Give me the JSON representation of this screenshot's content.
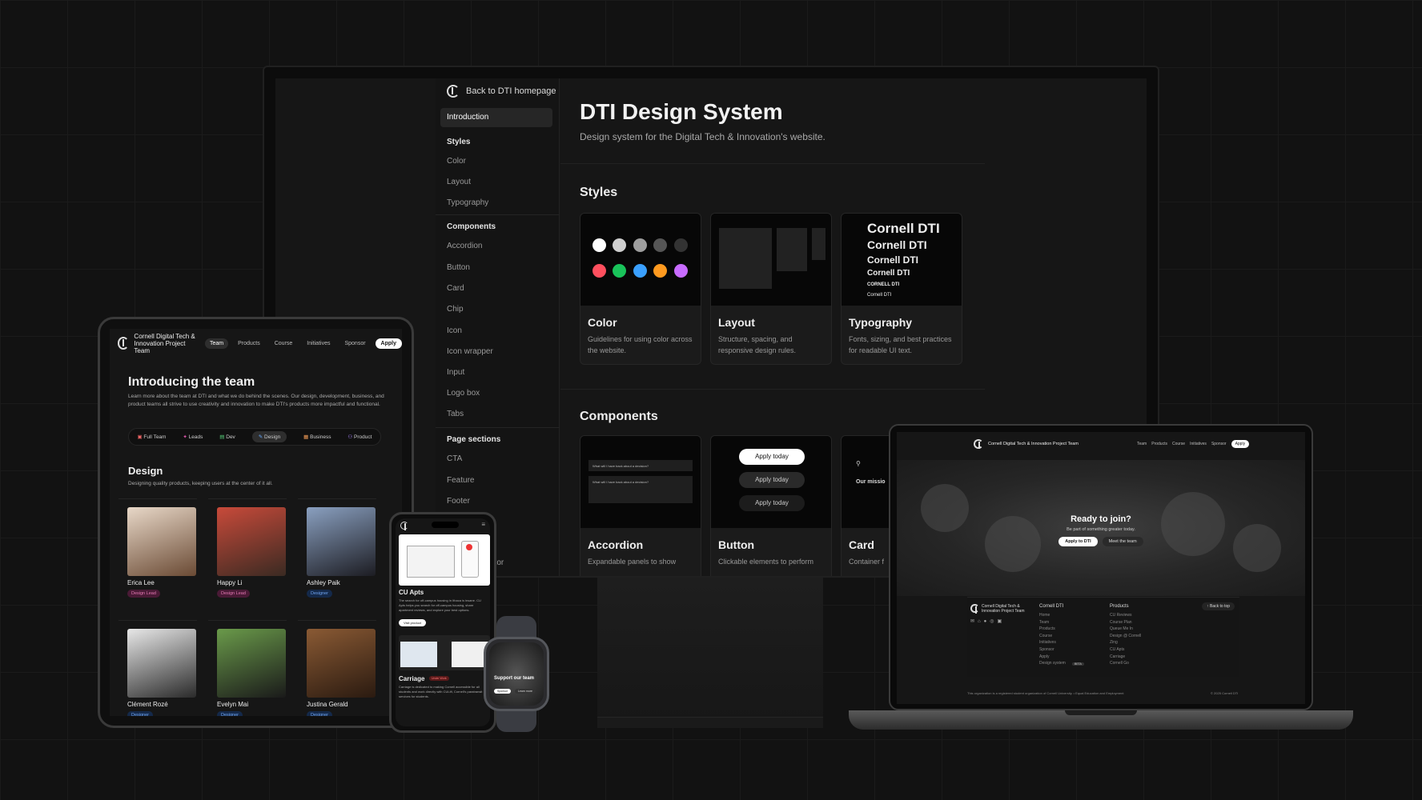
{
  "monitor": {
    "sidebar": {
      "back": "Back to DTI homepage",
      "active": "Introduction",
      "styles_head": "Styles",
      "styles": [
        "Color",
        "Layout",
        "Typography"
      ],
      "components_head": "Components",
      "components": [
        "Accordion",
        "Button",
        "Card",
        "Chip",
        "Icon",
        "Icon wrapper",
        "Input",
        "Logo box",
        "Tabs"
      ],
      "sections_head": "Page sections",
      "sections": [
        "CTA",
        "Feature",
        "Footer"
      ],
      "partial": "ator"
    },
    "title": "DTI Design System",
    "subtitle": "Design system for the Digital Tech & Innovation's website.",
    "styles_heading": "Styles",
    "style_cards": [
      {
        "title": "Color",
        "desc": "Guidelines for using color across the website."
      },
      {
        "title": "Layout",
        "desc": "Structure, spacing, and responsive design rules."
      },
      {
        "title": "Typography",
        "desc": "Fonts, sizing, and best practices for readable UI text."
      }
    ],
    "typo_samples": [
      "Cornell DTI",
      "Cornell DTI",
      "Cornell DTI",
      "Cornell DTI",
      "CORNELL DTI",
      "Cornell DTI"
    ],
    "palette": [
      "#ffffff",
      "#cfcfcf",
      "#9e9e9e",
      "#555555",
      "#333333",
      "#ff4f5e",
      "#19c35a",
      "#3aa0ff",
      "#ff9a1f",
      "#c86bff"
    ],
    "components_heading": "Components",
    "component_cards": [
      {
        "title": "Accordion",
        "desc": "Expandable panels to show"
      },
      {
        "title": "Button",
        "desc": "Clickable elements to perform"
      },
      {
        "title": "Card",
        "desc": "Container f"
      }
    ],
    "accordion_q1": "What will I have back about a decision?",
    "accordion_q2": "What will I have back about a decision?",
    "button_label": "Apply today",
    "card_partial": "Our missio"
  },
  "tablet": {
    "brand": "Cornell Digital Tech & Innovation Project Team",
    "nav": [
      "Team",
      "Products",
      "Course",
      "Initiatives",
      "Sponsor"
    ],
    "apply": "Apply",
    "title": "Introducing the team",
    "desc": "Learn more about the team at DTI and what we do behind the scenes. Our design, development, business, and product teams all strive to use creativity and innovation to make DTI's products more impactful and functional.",
    "chips": [
      "Full Team",
      "Leads",
      "Dev",
      "Design",
      "Business",
      "Product"
    ],
    "section": "Design",
    "section_sub": "Designing quality products, keeping users at the center of it all.",
    "members": [
      {
        "name": "Erica Lee",
        "role": "Design Lead",
        "type": "lead",
        "c1": "#e8d8c8",
        "c2": "#6a4a34"
      },
      {
        "name": "Happy Li",
        "role": "Design Lead",
        "type": "lead",
        "c1": "#c84a3a",
        "c2": "#3a2a22"
      },
      {
        "name": "Ashley Paik",
        "role": "Designer",
        "type": "des",
        "c1": "#8aa0c0",
        "c2": "#1c1c22"
      },
      {
        "name": "Clément Rozé",
        "role": "Designer",
        "type": "des",
        "c1": "#e8e8e8",
        "c2": "#2a2a2a"
      },
      {
        "name": "Evelyn Mai",
        "role": "Designer",
        "type": "des",
        "c1": "#6a9a4a",
        "c2": "#1a1a1a"
      },
      {
        "name": "Justina Gerald",
        "role": "Designer",
        "type": "des",
        "c1": "#8a5a34",
        "c2": "#2a1a10"
      }
    ]
  },
  "phone": {
    "card1_title": "CU Apts",
    "card1_desc": "The search for off-campus housing in Ithaca is insane. CU Apts helps you search for off-campus housing, share apartment reviews, and explore your best options.",
    "card1_btn": "Visit product",
    "card2_title": "Carriage",
    "card2_badge": "Under Work",
    "card2_desc": "Carriage is dedicated to making Cornell accessible for all students and work directly with CULift, Cornell's paratransit services for students."
  },
  "watch": {
    "title": "Support our team",
    "btn1": "Sponsor",
    "btn2": "Learn more"
  },
  "laptop": {
    "brand": "Cornell Digital Tech & Innovation Project Team",
    "nav": [
      "Team",
      "Products",
      "Course",
      "Initiatives",
      "Sponsor"
    ],
    "apply": "Apply",
    "hero_title": "Ready to join?",
    "hero_sub": "Be part of something greater today.",
    "btn_apply": "Apply to DTI",
    "btn_meet": "Meet the team",
    "footer_brand": "Cornell Digital Tech & Innovation Project Team",
    "col1_head": "Cornell DTI",
    "col1": [
      "Home",
      "Team",
      "Products",
      "Course",
      "Initiatives",
      "Sponsor",
      "Apply",
      "Design system"
    ],
    "beta": "BETA",
    "col2_head": "Products",
    "col2": [
      "CU Reviews",
      "Course Plan",
      "Queue Me In",
      "Design @ Cornell",
      "Zing",
      "CU Apts",
      "Carriage",
      "Cornell Go"
    ],
    "back_top": "Back to top",
    "legal": "This organization is a registered student organization of Cornell University. • Equal Education and Employment",
    "copyright": "© 2025 Cornell DTI"
  }
}
